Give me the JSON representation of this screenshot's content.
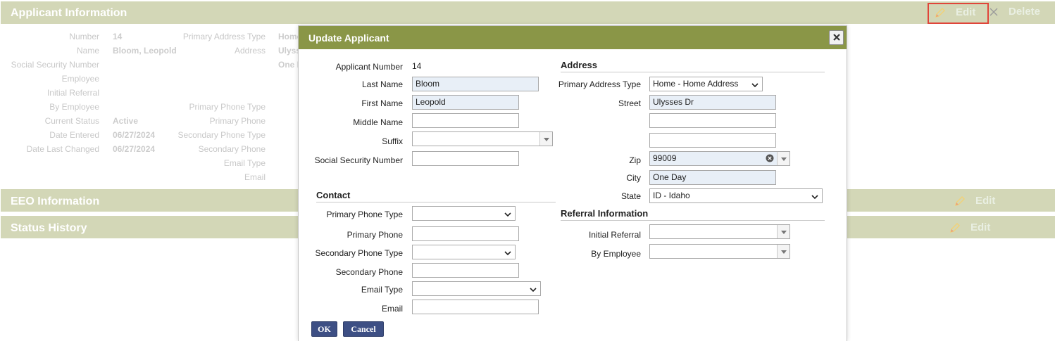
{
  "sections": {
    "applicant": {
      "title": "Applicant Information",
      "edit": "Edit",
      "delete": "Delete"
    },
    "eeo": {
      "title": "EEO Information",
      "edit": "Edit"
    },
    "status": {
      "title": "Status History",
      "edit": "Edit"
    }
  },
  "background": {
    "labels_left": [
      "Number",
      "Name",
      "Social Security Number",
      "Employee",
      "Initial Referral",
      "By Employee",
      "Current Status",
      "Date Entered",
      "Date Last Changed"
    ],
    "values_left": [
      "14",
      "Bloom, Leopold",
      "",
      "",
      "",
      "",
      "Active",
      "06/27/2024",
      "06/27/2024"
    ],
    "labels_mid": [
      "Primary Address Type",
      "Address",
      "",
      "",
      "",
      "Primary Phone Type",
      "Primary Phone",
      "Secondary Phone Type",
      "Secondary Phone",
      "Email Type",
      "Email"
    ],
    "values_mid": [
      "Home",
      "Ulyss",
      "One D"
    ]
  },
  "dialog": {
    "title": "Update Applicant",
    "applicant_number_label": "Applicant Number",
    "applicant_number": "14",
    "last_name_label": "Last Name",
    "last_name": "Bloom",
    "first_name_label": "First Name",
    "first_name": "Leopold",
    "middle_name_label": "Middle Name",
    "middle_name": "",
    "suffix_label": "Suffix",
    "suffix": "",
    "ssn_label": "Social Security Number",
    "ssn": "",
    "contact_title": "Contact",
    "primary_phone_type_label": "Primary Phone Type",
    "primary_phone_type": "",
    "primary_phone_label": "Primary Phone",
    "primary_phone": "",
    "secondary_phone_type_label": "Secondary Phone Type",
    "secondary_phone_type": "",
    "secondary_phone_label": "Secondary Phone",
    "secondary_phone": "",
    "email_type_label": "Email Type",
    "email_type": "",
    "email_label": "Email",
    "email": "",
    "address_title": "Address",
    "primary_address_type_label": "Primary Address Type",
    "primary_address_type": "Home - Home Address",
    "street_label": "Street",
    "street1": "Ulysses Dr",
    "street2": "",
    "street3": "",
    "zip_label": "Zip",
    "zip": "99009",
    "city_label": "City",
    "city": "One Day",
    "state_label": "State",
    "state": "ID - Idaho",
    "referral_title": "Referral Information",
    "initial_referral_label": "Initial Referral",
    "initial_referral": "",
    "by_employee_label": "By Employee",
    "by_employee": "",
    "ok": "OK",
    "cancel": "Cancel"
  },
  "colors": {
    "section_bar": "#d3d7b7",
    "dialog_header": "#8a9647",
    "button": "#3d4f84",
    "highlight": "#e0453a",
    "filled_field": "#e8eff7"
  },
  "icons": [
    "pencil-icon",
    "close-icon",
    "chevron-down-icon",
    "clear-circle-icon",
    "triangle-down-icon"
  ]
}
